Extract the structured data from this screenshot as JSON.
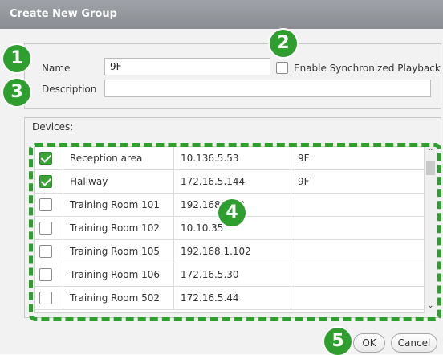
{
  "dialog": {
    "title": "Create New Group"
  },
  "form": {
    "name_label": "Name",
    "name_value": "9F",
    "description_label": "Description",
    "description_value": "",
    "sync_label": "Enable Synchronized Playback",
    "sync_checked": false
  },
  "devices": {
    "title": "Devices:",
    "rows": [
      {
        "checked": true,
        "name": "Reception area",
        "ip": "10.136.5.53",
        "group": "9F"
      },
      {
        "checked": true,
        "name": "Hallway",
        "ip": "172.16.5.144",
        "group": "9F"
      },
      {
        "checked": false,
        "name": "Training Room 101",
        "ip": "192.168.1.82",
        "group": ""
      },
      {
        "checked": false,
        "name": "Training Room 102",
        "ip": "10.10.35",
        "group": ""
      },
      {
        "checked": false,
        "name": "Training Room 105",
        "ip": "192.168.1.102",
        "group": ""
      },
      {
        "checked": false,
        "name": "Training Room 106",
        "ip": "172.16.5.30",
        "group": ""
      },
      {
        "checked": false,
        "name": "Training Room 502",
        "ip": "172.16.5.44",
        "group": ""
      }
    ]
  },
  "buttons": {
    "ok": "OK",
    "cancel": "Cancel"
  },
  "annotations": [
    "1",
    "2",
    "3",
    "4",
    "5"
  ],
  "colors": {
    "accent": "#2e9e2e",
    "check": "#3aa335",
    "title_bar": "#939699"
  }
}
